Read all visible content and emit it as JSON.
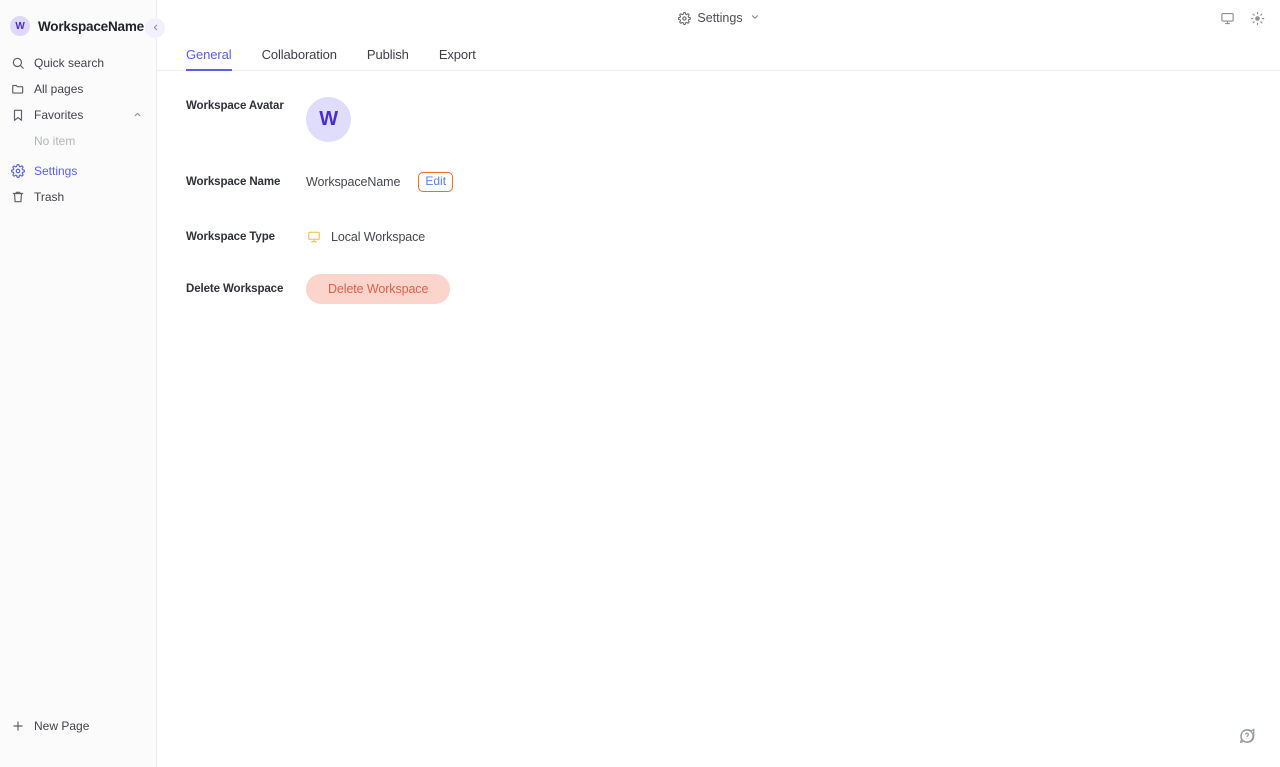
{
  "sidebar": {
    "workspace": {
      "avatar_initial": "W",
      "name": "WorkspaceName",
      "avatar_bg": "#ded9fb",
      "avatar_fg": "#4c2ecf"
    },
    "collapse_icon": "chevron-left-icon",
    "items": [
      {
        "label": "Quick search",
        "icon": "search-icon",
        "active": false
      },
      {
        "label": "All pages",
        "icon": "folder-icon",
        "active": false
      },
      {
        "label": "Favorites",
        "icon": "bookmark-icon",
        "active": false,
        "chevron": "chevron-up-icon"
      },
      {
        "label": "Settings",
        "icon": "gear-icon",
        "active": true
      },
      {
        "label": "Trash",
        "icon": "trash-icon",
        "active": false
      }
    ],
    "empty_state": "No item",
    "new_page": {
      "label": "New Page",
      "icon": "plus-icon"
    }
  },
  "topbar": {
    "breadcrumb": {
      "label": "Settings",
      "icon": "gear-icon",
      "chevron": "chevron-down-icon"
    },
    "actions": [
      {
        "name": "display-icon",
        "title": "Display"
      },
      {
        "name": "brightness-icon",
        "title": "Appearance"
      }
    ]
  },
  "tabs": [
    {
      "label": "General",
      "active": true
    },
    {
      "label": "Collaboration",
      "active": false
    },
    {
      "label": "Publish",
      "active": false
    },
    {
      "label": "Export",
      "active": false
    }
  ],
  "general": {
    "avatar_row": {
      "label": "Workspace Avatar",
      "initial": "W",
      "bg": "#e0dcfb",
      "fg": "#4c2ecf"
    },
    "name_row": {
      "label": "Workspace Name",
      "value": "WorkspaceName",
      "edit_label": "Edit",
      "edit_color": "#5a7fe8",
      "highlight_color": "#f26b35"
    },
    "type_row": {
      "label": "Workspace Type",
      "value": "Local Workspace",
      "icon": "monitor-icon",
      "icon_color": "#f0c256"
    },
    "delete_row": {
      "label": "Delete Workspace",
      "button_label": "Delete Workspace",
      "button_bg": "#fbd5cb",
      "button_fg": "#e1604a"
    }
  },
  "help": {
    "icon": "help-bubble-icon"
  }
}
